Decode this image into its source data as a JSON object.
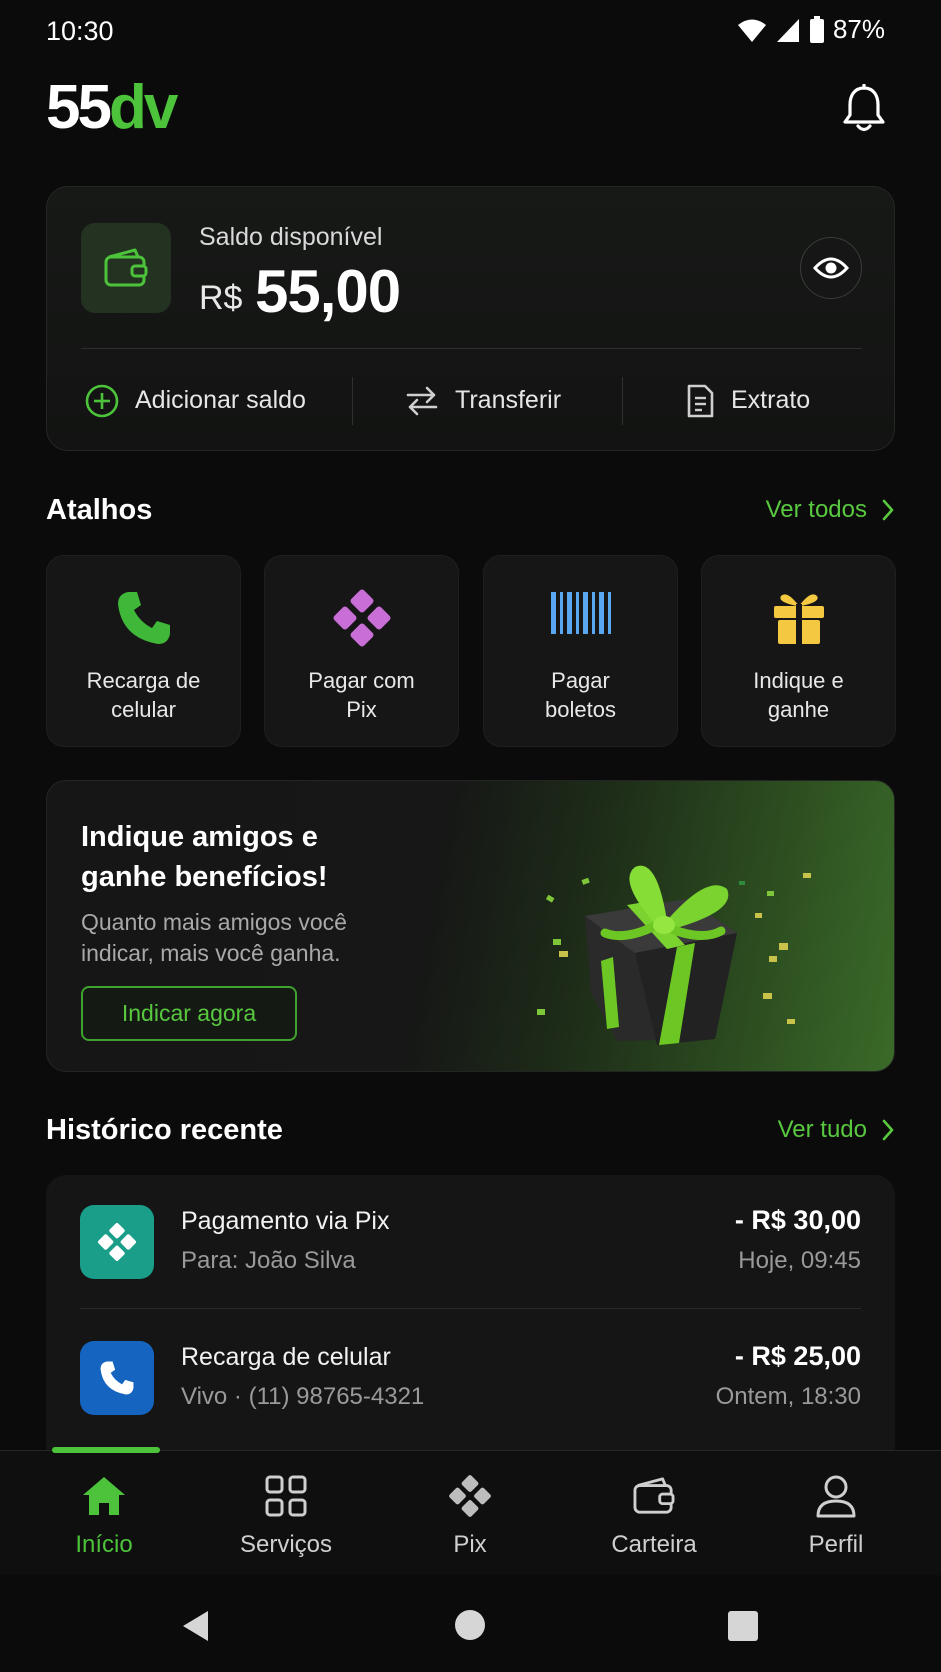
{
  "status_bar": {
    "time": "10:30",
    "battery": "87%"
  },
  "header": {
    "logo_main": "55",
    "logo_accent": "dv"
  },
  "balance": {
    "label": "Saldo disponível",
    "currency": "R$",
    "value": "55,00",
    "actions": [
      {
        "label": "Adicionar saldo",
        "icon": "plus-circle-icon"
      },
      {
        "label": "Transferir",
        "icon": "transfer-arrows-icon"
      },
      {
        "label": "Extrato",
        "icon": "receipt-icon"
      }
    ]
  },
  "shortcuts": {
    "title": "Atalhos",
    "see_all": "Ver todos",
    "items": [
      {
        "line1": "Recarga de",
        "line2": "celular",
        "icon": "phone-icon",
        "color": "#3fb83a"
      },
      {
        "line1": "Pagar com",
        "line2": "Pix",
        "icon": "pix-icon",
        "color": "#c96ed6"
      },
      {
        "line1": "Pagar",
        "line2": "boletos",
        "icon": "barcode-icon",
        "color": "#5aa8ef"
      },
      {
        "line1": "Indique e",
        "line2": "ganhe",
        "icon": "gift-icon",
        "color": "#f5c842"
      }
    ]
  },
  "promo": {
    "title": "Indique amigos e ganhe benefícios!",
    "text": "Quanto mais amigos você indicar, mais você ganha.",
    "button": "Indicar agora"
  },
  "history": {
    "title": "Histórico recente",
    "see_all": "Ver tudo",
    "items": [
      {
        "title": "Pagamento via Pix",
        "subtitle": "Para: João Silva",
        "amount": "- R$ 30,00",
        "when": "Hoje, 09:45",
        "icon": "pix-icon",
        "color": "#1a9e8a"
      },
      {
        "title": "Recarga de celular",
        "subtitle": "Vivo · (11) 98765-4321",
        "amount": "- R$ 25,00",
        "when": "Ontem, 18:30",
        "icon": "phone-icon",
        "color": "#1565c0"
      }
    ]
  },
  "bottom_nav": {
    "items": [
      {
        "label": "Início",
        "icon": "home-icon",
        "active": true
      },
      {
        "label": "Serviços",
        "icon": "grid-icon",
        "active": false
      },
      {
        "label": "Pix",
        "icon": "pix-icon",
        "active": false
      },
      {
        "label": "Carteira",
        "icon": "wallet-icon",
        "active": false
      },
      {
        "label": "Perfil",
        "icon": "user-icon",
        "active": false
      }
    ]
  },
  "colors": {
    "accent": "#4cc33a",
    "background": "#0b0b0b",
    "card": "#161616"
  }
}
